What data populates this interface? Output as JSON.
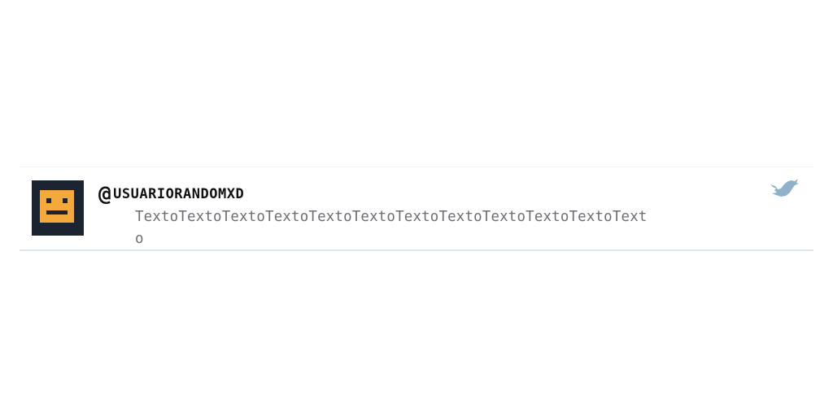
{
  "tweet": {
    "at_symbol": "@",
    "username": "USUARIORANDOMXD",
    "text": "TextoTextoTextoTextoTextoTextoTextoTextoTextoTextoTextoTexto",
    "avatar_icon": "pixel-robot-face-icon",
    "logo_icon": "twitter-bird-icon"
  },
  "colors": {
    "avatar_background": "#1c2331",
    "avatar_face": "#f4a93c",
    "username_text": "#111111",
    "body_text": "#6b6f73",
    "bird_icon": "#8fb1c9"
  }
}
